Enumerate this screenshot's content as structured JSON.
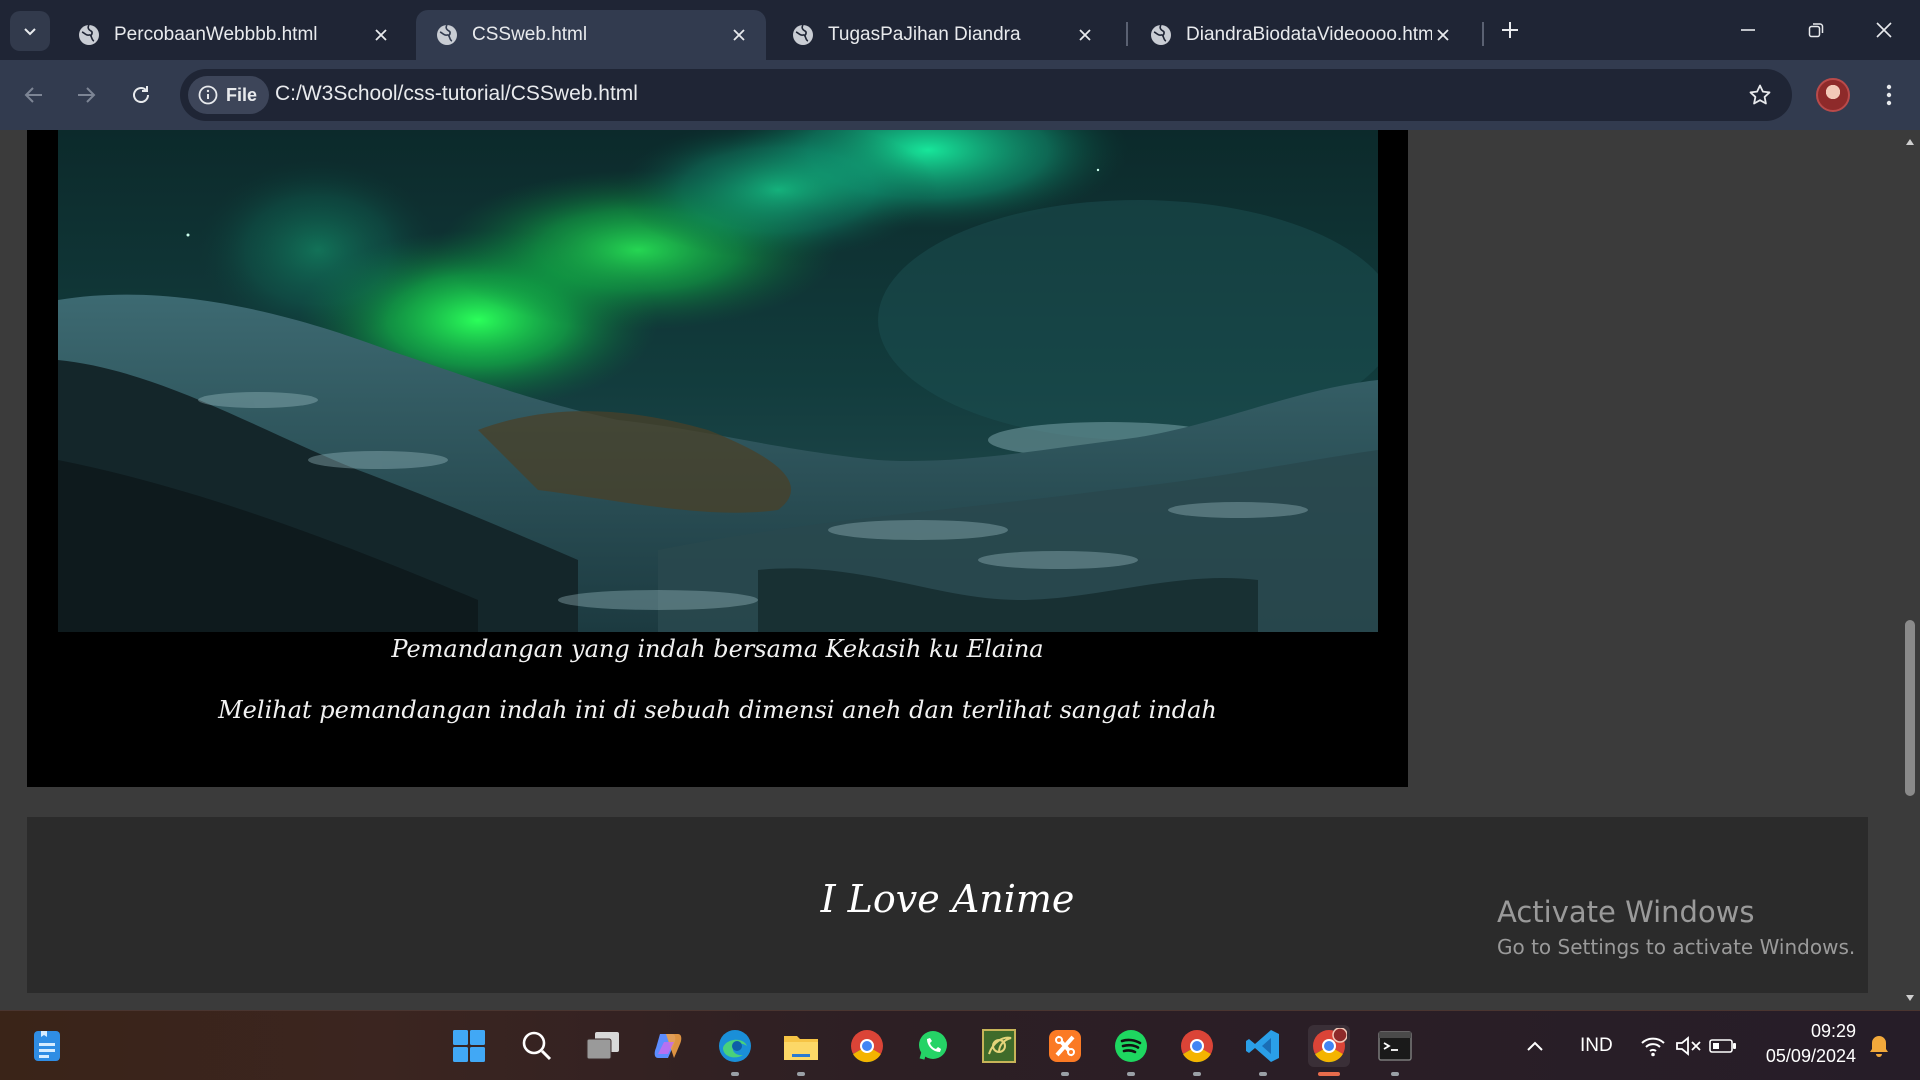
{
  "browser": {
    "tabs": [
      {
        "title": "PercobaanWebbbb.html",
        "active": false
      },
      {
        "title": "CSSweb.html",
        "active": true
      },
      {
        "title": "TugasPaJihan Diandra",
        "active": false
      },
      {
        "title": "DiandraBiodataVideoooo.html",
        "active": false
      }
    ],
    "site_chip_label": "File",
    "url": "C:/W3School/css-tutorial/CSSweb.html"
  },
  "page": {
    "caption_main": "Pemandangan yang indah bersama Kekasih ku Elaina",
    "caption_sub": "Melihat pemandangan indah ini di sebuah dimensi aneh dan terlihat sangat indah",
    "footer_title": "I Love Anime",
    "scroll_position": 0.56
  },
  "watermark": {
    "line1": "Activate Windows",
    "line2": "Go to Settings to activate Windows."
  },
  "taskbar": {
    "apps": [
      "windows-start-icon",
      "search-icon",
      "task-view-icon",
      "copilot-icon",
      "edge-icon",
      "file-explorer-icon",
      "chrome-icon",
      "whatsapp-icon",
      "app-green-icon",
      "xampp-icon",
      "spotify-icon",
      "chrome-icon",
      "vscode-icon",
      "chrome-profile-icon",
      "terminal-icon"
    ],
    "language": "IND",
    "time": "09:29",
    "date": "05/09/2024"
  },
  "colors": {
    "tabbar": "#1f2535",
    "toolbar": "#323b4f",
    "page_bg": "#3b3b3b",
    "card_bg": "#000000",
    "footer_bg": "#2b2b2b",
    "aurora_green": "#19e36a"
  }
}
